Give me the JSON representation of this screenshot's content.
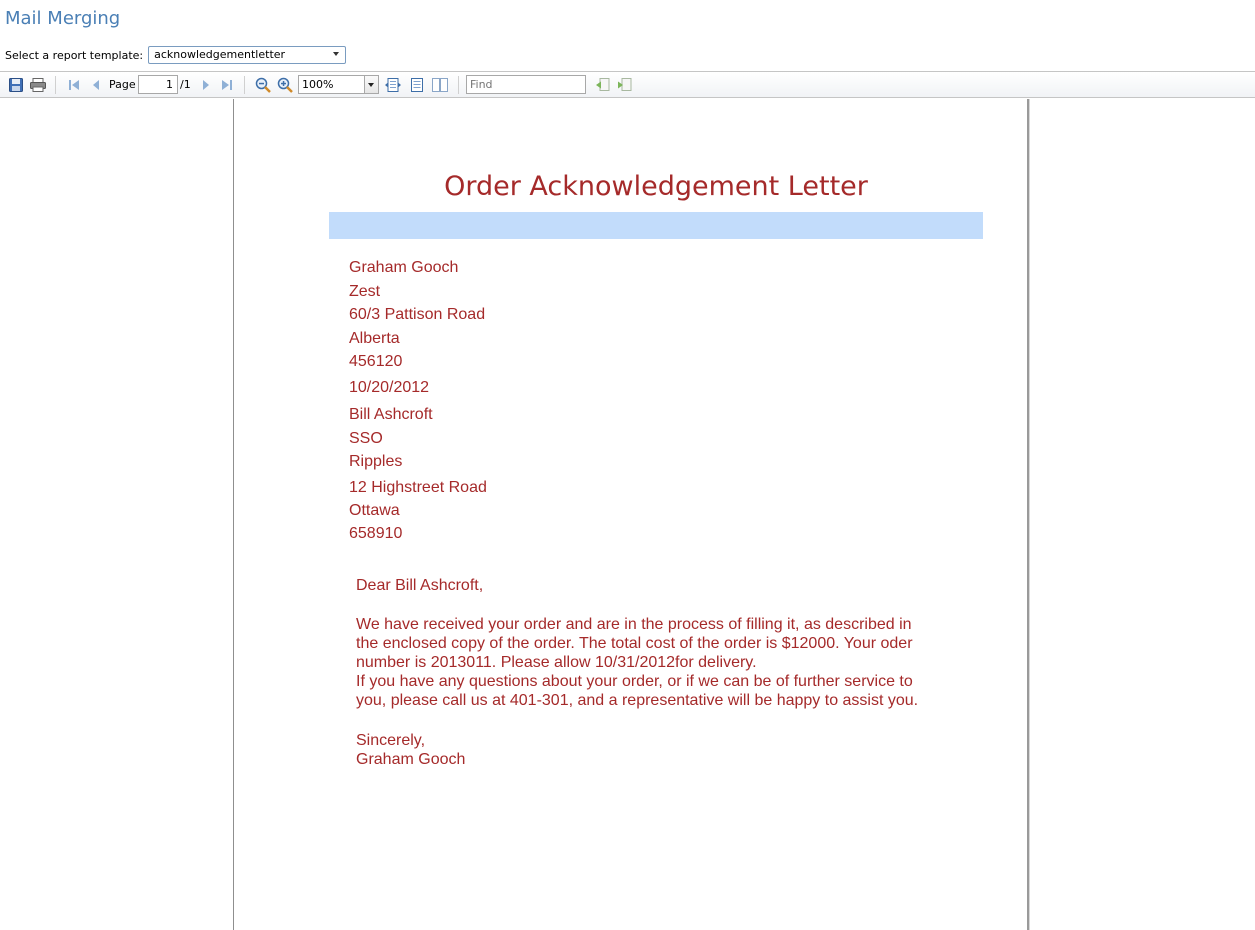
{
  "app": {
    "title": "Mail Merging"
  },
  "template_selector": {
    "label": "Select a report template:",
    "value": "acknowledgementletter"
  },
  "toolbar": {
    "page_label": "Page",
    "page_current": "1",
    "page_total": "/1",
    "zoom": "100%",
    "find_placeholder": "Find"
  },
  "letter": {
    "title": "Order Acknowledgement Letter",
    "sender": {
      "name": "Graham Gooch",
      "company": "Zest",
      "street": "60/3 Pattison Road",
      "region": "Alberta",
      "postal": "456120"
    },
    "date": "10/20/2012",
    "recipient": {
      "name": "Bill Ashcroft",
      "title": "SSO",
      "company": "Ripples",
      "street": "12 Highstreet Road",
      "city": "Ottawa",
      "postal": "658910"
    },
    "salutation": "Dear Bill Ashcroft,",
    "body_lines": [
      "We have received your order and are in the process of filling it, as described in",
      "the enclosed copy of the order. The total cost of the order is $12000. Your oder",
      "number is 2013011. Please allow 10/31/2012for delivery.",
      "If you have any questions about your order, or if we can be of further service to",
      "you, please call us at 401-301, and a representative will be happy to assist you."
    ],
    "closing": "Sincerely,",
    "signature": "Graham Gooch"
  },
  "colors": {
    "letter_text": "#a52a2a",
    "title_band": "#c2dcfb",
    "app_title": "#4a7fb5"
  }
}
